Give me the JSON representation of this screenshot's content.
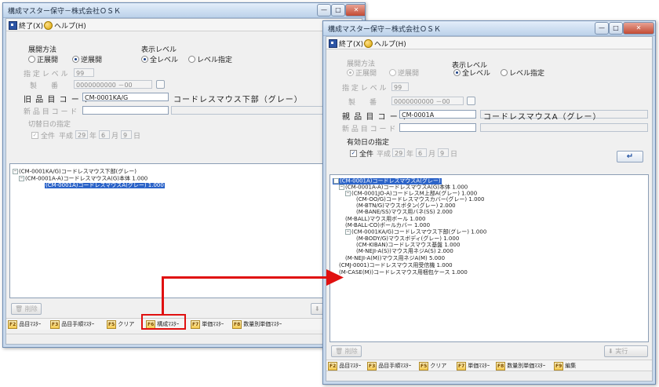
{
  "colors": {
    "accent": "#e01010",
    "selection": "#2b63c8",
    "window_frame": "#c9d9ec"
  },
  "left": {
    "title": "構成マスター保守－株式会社ＯＳＫ",
    "menu": {
      "exit": "終了(X)",
      "help": "ヘルプ(H)"
    },
    "expand_method_label": "展開方法",
    "expand_forward": "正展開",
    "expand_reverse": "逆展開",
    "display_level_label": "表示レベル",
    "level_all": "全レベル",
    "level_specified": "レベル指定",
    "specified_level_label": "指 定 レ ベ ル",
    "specified_level_value": "99",
    "serial_label": "製　　番",
    "serial_value": "0000000000 －00",
    "code_label": "旧 品 目 コ ー ド",
    "code_value": "CM-0001KA/G",
    "code_name": "コードレスマウス下部（グレー）",
    "new_code_label": "新 品 目 コ ー ド",
    "switch_date_label": "切替日の指定",
    "all_label": "全件",
    "era": "平成",
    "year": "29",
    "year_unit": "年",
    "month": "6",
    "month_unit": "月",
    "day": "9",
    "day_unit": "日",
    "tree": [
      "(CM-0001KA/G)コードレスマウス下部(グレー)",
      "(CM-0001A-A)コードレスマウスA(G)本体 1.000",
      "(CM-0001A)コードレスマウスA(グレー) 1.000"
    ],
    "delete_label": "削除",
    "fkeys": [
      {
        "key": "F2",
        "label": "品目ﾏｽﾀｰ"
      },
      {
        "key": "F3",
        "label": "品目手順ﾏｽﾀｰ"
      },
      {
        "key": "F5",
        "label": "クリア"
      },
      {
        "key": "F6",
        "label": "構成ﾏｽﾀｰ"
      },
      {
        "key": "F7",
        "label": "単価ﾏｽﾀｰ"
      },
      {
        "key": "F8",
        "label": "数量別単価ﾏｽﾀｰ"
      }
    ]
  },
  "right": {
    "title": "構成マスター保守－株式会社ＯＳＫ",
    "menu": {
      "exit": "終了(X)",
      "help": "ヘルプ(H)"
    },
    "expand_method_label": "展開方法",
    "expand_forward": "正展開",
    "expand_reverse": "逆展開",
    "display_level_label": "表示レベル",
    "level_all": "全レベル",
    "level_specified": "レベル指定",
    "specified_level_label": "指 定 レ ベ ル",
    "specified_level_value": "99",
    "serial_label": "製　　番",
    "serial_value": "0000000000 －00",
    "code_label": "親 品 目 コ ー ド",
    "code_value": "CM-0001A",
    "code_name": "コードレスマウスA（グレー）",
    "new_code_label": "新 品 目 コ ー ド",
    "effective_date_label": "有効日の指定",
    "all_label": "全件",
    "era": "平成",
    "year": "29",
    "year_unit": "年",
    "month": "6",
    "month_unit": "月",
    "day": "9",
    "day_unit": "日",
    "tree": [
      "(CM-0001A)コードレスマウスA(グレー)",
      "(CM-0001A-A)コードレスマウスA(G)本体 1.000",
      "(CM-0001JO-A)コードレスM上部A(グレー) 1.000",
      "(CM-OO/G)コードレスマウスカバー(グレー) 1.000",
      "(M-BTN/G)マウスボタン(グレー) 2.000",
      "(M-BANE/SS)マウス用バネ(SS) 2.000",
      "(M-BALL)マウス用ボール 1.000",
      "(M-BALL-CO)ボールカバー 1.000",
      "(CM-0001KA/G)コードレスマウス下部(グレー) 1.000",
      "(M-BODY/G)マウスボディ(グレー) 1.000",
      "(CM-KIBAN)コードレスマウス基盤 1.000",
      "(M-NEJI-A(S))マウス用ネジA(S) 2.000",
      "(M-NEJI-A(M))マウス用ネジA(M) 5.000",
      "(CMJ-0001)コードレスマウス用受信機 1.000",
      "(M-CASE(M))コードレスマウス用梱包ケース 1.000"
    ],
    "delete_label": "削除",
    "exec_label": "実行",
    "fkeys": [
      {
        "key": "F2",
        "label": "品目ﾏｽﾀｰ"
      },
      {
        "key": "F3",
        "label": "品目手順ﾏｽﾀｰ"
      },
      {
        "key": "F5",
        "label": "クリア"
      },
      {
        "key": "F7",
        "label": "単価ﾏｽﾀｰ"
      },
      {
        "key": "F8",
        "label": "数量別単価ﾏｽﾀｰ"
      },
      {
        "key": "F9",
        "label": "編集"
      }
    ]
  }
}
